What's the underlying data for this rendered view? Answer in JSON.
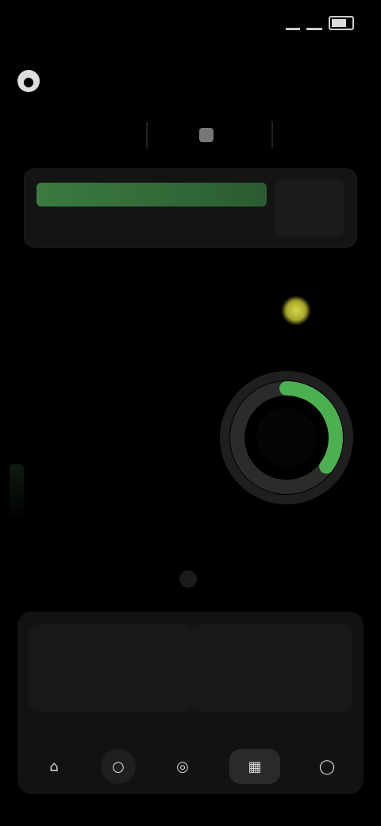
{
  "status_bar": {
    "time": "",
    "icons": [
      "signal-icon",
      "wifi-icon",
      "battery-icon"
    ]
  },
  "app": {
    "name": "",
    "brand_icon": "brand-icon"
  },
  "tabs": [
    {
      "label": "",
      "icon": ""
    },
    {
      "label": "",
      "icon": "tab-icon"
    },
    {
      "label": "",
      "icon": ""
    }
  ],
  "banner": {
    "title": "",
    "subtitle": "",
    "aside_text": ""
  },
  "score": {
    "primary_value": "",
    "primary_caption": "",
    "secondary_value": "",
    "secondary_caption": "",
    "ring_progress": 0.35,
    "ring_color": "#4CAF50",
    "ring_track_color": "#2b2b2b"
  },
  "cards": {
    "left": {
      "title": "",
      "value": "",
      "badge": ""
    },
    "right": {
      "title": "",
      "value": "",
      "badge": ""
    }
  },
  "nav": {
    "items": [
      {
        "icon": "home-icon"
      },
      {
        "icon": "circle-icon"
      },
      {
        "icon": "compass-icon"
      },
      {
        "icon": "grid-icon"
      },
      {
        "icon": "profile-icon"
      }
    ]
  },
  "colors": {
    "background": "#000000",
    "banner_accent": "#3c7a41",
    "trophy": "#d7d64a"
  }
}
